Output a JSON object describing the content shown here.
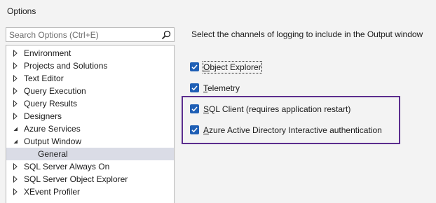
{
  "window": {
    "title": "Options"
  },
  "search": {
    "placeholder": "Search Options (Ctrl+E)"
  },
  "tree": {
    "items": [
      {
        "label": "Environment",
        "expanded": false
      },
      {
        "label": "Projects and Solutions",
        "expanded": false
      },
      {
        "label": "Text Editor",
        "expanded": false
      },
      {
        "label": "Query Execution",
        "expanded": false
      },
      {
        "label": "Query Results",
        "expanded": false
      },
      {
        "label": "Designers",
        "expanded": false
      },
      {
        "label": "Azure Services",
        "expanded": true
      },
      {
        "label": "Output Window",
        "expanded": true
      },
      {
        "label": "General",
        "child": true,
        "selected": true
      },
      {
        "label": "SQL Server Always On",
        "expanded": false
      },
      {
        "label": "SQL Server Object Explorer",
        "expanded": false
      },
      {
        "label": "XEvent Profiler",
        "expanded": false
      }
    ]
  },
  "content": {
    "heading": "Select the channels of logging to include in the Output window",
    "options": [
      {
        "mnemonic": "O",
        "rest": "bject Explorer",
        "checked": true
      },
      {
        "mnemonic": "T",
        "rest": "elemetry",
        "checked": true
      },
      {
        "mnemonic": "S",
        "rest": "QL Client (requires application restart)",
        "checked": true
      },
      {
        "mnemonic": "A",
        "rest": "zure Active Directory Interactive authentication",
        "checked": true
      }
    ]
  },
  "colors": {
    "accent": "#1f5fb5",
    "highlight_box": "#5b2d8e",
    "selected_row": "#dadce6"
  }
}
